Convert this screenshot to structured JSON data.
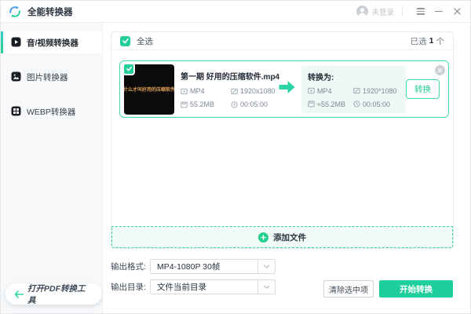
{
  "window": {
    "title": "全能转换器",
    "login": "未登录"
  },
  "sidebar": {
    "items": [
      {
        "label": "音/视频转换器"
      },
      {
        "label": "图片转换器"
      },
      {
        "label": "WEBP转换器"
      }
    ],
    "pdf_tool_label": "打开PDF转换工具"
  },
  "list": {
    "select_all_label": "全选",
    "selected_prefix": "已选",
    "selected_count": "1",
    "selected_suffix": "个",
    "add_file_label": "添加文件"
  },
  "file_card": {
    "thumbnail_text": "什么才叫好用的压缩软件",
    "name": "第一期 好用的压缩软件.mp4",
    "source": {
      "format": "MP4",
      "resolution": "1920x1080",
      "size": "55.2MB",
      "duration": "00:05:00"
    },
    "target_label": "转换为:",
    "target": {
      "format": "MP4",
      "resolution": "1920*1080",
      "size": "≈55.2MB",
      "duration": "00:05:00"
    },
    "convert_label": "转换"
  },
  "output": {
    "format_label": "输出格式:",
    "format_value": "MP4-1080P 30帧",
    "dir_label": "输出目录:",
    "dir_value": "文件当前目录"
  },
  "actions": {
    "clear_label": "清除选中项",
    "start_label": "开始转换"
  },
  "colors": {
    "primary_green": "#1fce9d",
    "card_border": "#4ad7ab",
    "checkbox_green": "#23ce9c",
    "logo_blue": "#4aa0ee",
    "logo_teal": "#2bd1a0",
    "thumb_text_orange": "#df9f58",
    "sidebar_bg": "#f6f8fa"
  },
  "icons": {
    "logo": "circular-swap-arrows",
    "avatar": "person-circle",
    "titlebar": [
      "menu",
      "minimize",
      "close"
    ],
    "sidebar": [
      "video-play",
      "image-picture",
      "webp-grid"
    ],
    "meta": [
      "format-play",
      "resolution-screen",
      "size-file",
      "duration-clock"
    ]
  }
}
